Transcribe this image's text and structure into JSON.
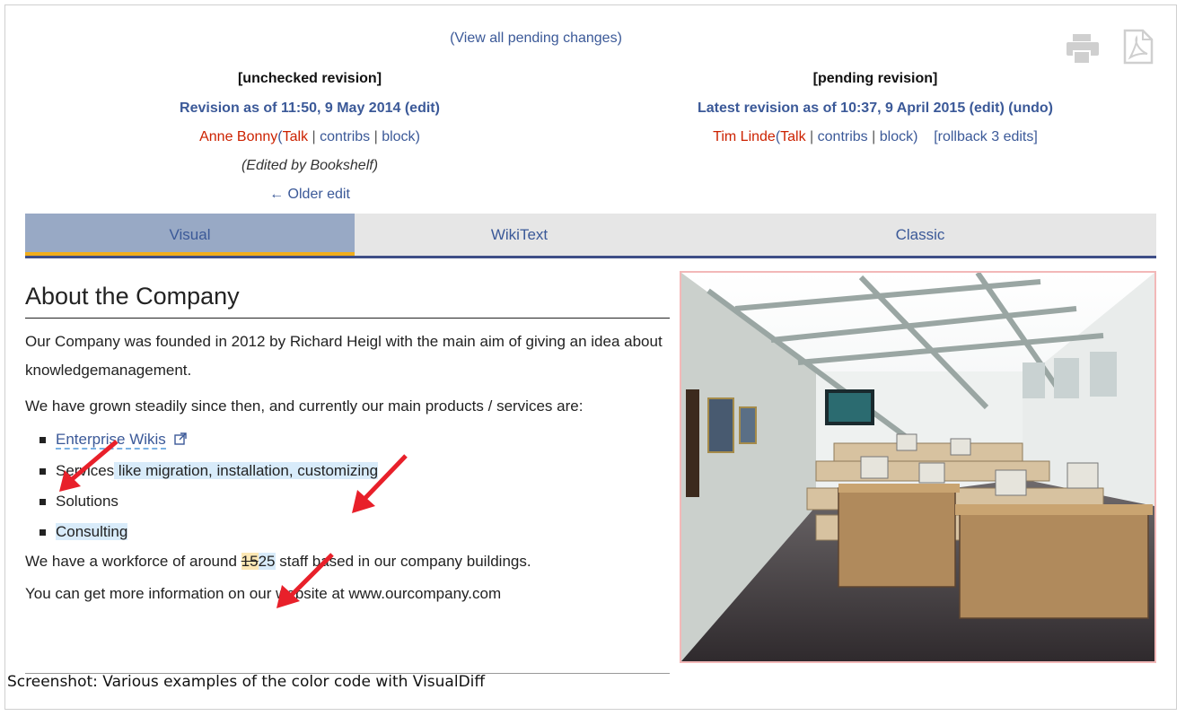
{
  "header": {
    "view_pending": "(View all pending changes)",
    "left": {
      "label": "[unchecked revision]",
      "revision": "Revision as of 11:50, 9 May 2014",
      "edit": "(edit)",
      "user": "Anne Bonny",
      "talk": "Talk",
      "contribs": "contribs",
      "block": "block",
      "edited_by": "(Edited by Bookshelf)",
      "older_edit": "← Older edit"
    },
    "right": {
      "label": "[pending revision]",
      "revision": "Latest revision as of 10:37, 9 April 2015",
      "edit": "(edit)",
      "undo": "(undo)",
      "user": "Tim Linde",
      "talk": "Talk",
      "contribs": "contribs",
      "block": "block",
      "rollback": "[rollback 3 edits]"
    },
    "icons": [
      "print-icon",
      "pdf-icon"
    ]
  },
  "tabs": [
    {
      "label": "Visual",
      "active": true
    },
    {
      "label": "WikiText",
      "active": false
    },
    {
      "label": "Classic",
      "active": false
    }
  ],
  "article": {
    "heading": "About the Company",
    "p1": "Our Company was founded in 2012 by Richard Heigl with the main aim of giving an idea about knowledgemanagement.",
    "p2": "We have grown steadily since then, and currently our main products / services are:",
    "list": {
      "item1": "Enterprise Wikis",
      "item2_plain": "Services",
      "item2_added": " like migration, installation, customizing",
      "item3": "Solutions",
      "item4": "Consulting"
    },
    "p3_before": "We have a workforce of around ",
    "p3_old": "15",
    "p3_new": "25",
    "p3_after": " staff based in our company buildings.",
    "p4": "You can get more information on our website at www.ourcompany.com"
  },
  "caption": "Screenshot: Various examples of the color code with VisualDiff",
  "colors": {
    "link": "#3b5998",
    "user_red": "#cc2200",
    "added_highlight": "#d8ebfa",
    "removed_highlight": "#fbe7b4",
    "active_tab": "#98a9c5",
    "tab_underline": "#f0ad1d",
    "arrow": "#e8202a"
  }
}
